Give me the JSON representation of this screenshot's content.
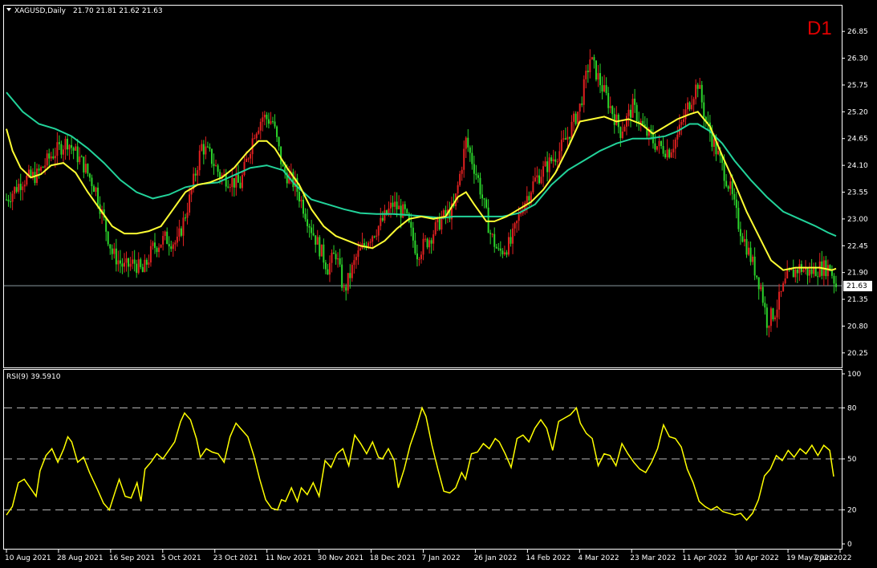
{
  "header": {
    "symbol": "XAGUSD,Daily",
    "ohlc": "21.70 21.81 21.62 21.63",
    "timeframe_badge": "D1"
  },
  "rsi_header": {
    "label": "RSI(9) 39.5910"
  },
  "last_price_label": "21.63",
  "colors": {
    "background": "#000000",
    "bull": "#e02020",
    "bear": "#2bd42b",
    "fast_ma": "#ffff33",
    "slow_ma": "#22d39a",
    "rsi": "#ffff00",
    "grid": "#ffffff",
    "last_price_line": "#8a9aa0"
  },
  "chart_data": [
    {
      "type": "candlestick",
      "title": "XAGUSD,Daily",
      "ylim": [
        20.05,
        27.1
      ],
      "y_ticks": [
        "26.85",
        "26.30",
        "25.75",
        "25.20",
        "24.65",
        "24.10",
        "23.55",
        "23.00",
        "22.45",
        "21.90",
        "21.35",
        "20.80",
        "20.25"
      ],
      "x_ticks": [
        "10 Aug 2021",
        "28 Aug 2021",
        "16 Sep 2021",
        "5 Oct 2021",
        "23 Oct 2021",
        "11 Nov 2021",
        "30 Nov 2021",
        "18 Dec 2021",
        "7 Jan 2022",
        "26 Jan 2022",
        "14 Feb 2022",
        "4 Mar 2022",
        "23 Mar 2022",
        "11 Apr 2022",
        "30 Apr 2022",
        "19 May 2022",
        "7 Jun 2022"
      ],
      "last_price": 21.63,
      "close_path": [
        [
          0,
          23.4
        ],
        [
          8,
          23.8
        ],
        [
          15,
          23.9
        ],
        [
          22,
          24.3
        ],
        [
          30,
          24.6
        ],
        [
          38,
          24.1
        ],
        [
          44,
          23.6
        ],
        [
          52,
          22.3
        ],
        [
          58,
          22.0
        ],
        [
          63,
          22.1
        ],
        [
          67,
          21.9
        ],
        [
          72,
          22.4
        ],
        [
          78,
          22.6
        ],
        [
          84,
          22.5
        ],
        [
          90,
          23.4
        ],
        [
          96,
          24.5
        ],
        [
          100,
          24.3
        ],
        [
          105,
          23.9
        ],
        [
          110,
          23.8
        ],
        [
          115,
          23.7
        ],
        [
          122,
          24.8
        ],
        [
          126,
          25.1
        ],
        [
          131,
          25.0
        ],
        [
          136,
          24.0
        ],
        [
          142,
          23.7
        ],
        [
          150,
          22.8
        ],
        [
          158,
          22.0
        ],
        [
          162,
          22.3
        ],
        [
          166,
          21.5
        ],
        [
          172,
          22.2
        ],
        [
          178,
          22.6
        ],
        [
          184,
          22.9
        ],
        [
          190,
          23.3
        ],
        [
          196,
          23.1
        ],
        [
          202,
          22.3
        ],
        [
          208,
          22.6
        ],
        [
          214,
          23.0
        ],
        [
          220,
          23.2
        ],
        [
          226,
          24.6
        ],
        [
          232,
          23.8
        ],
        [
          238,
          22.7
        ],
        [
          242,
          22.3
        ],
        [
          248,
          22.5
        ],
        [
          254,
          23.3
        ],
        [
          260,
          23.8
        ],
        [
          266,
          24.1
        ],
        [
          272,
          24.4
        ],
        [
          276,
          24.7
        ],
        [
          282,
          25.3
        ],
        [
          287,
          26.3
        ],
        [
          292,
          25.8
        ],
        [
          296,
          25.4
        ],
        [
          302,
          24.8
        ],
        [
          308,
          25.3
        ],
        [
          314,
          24.8
        ],
        [
          320,
          24.5
        ],
        [
          326,
          24.4
        ],
        [
          330,
          24.7
        ],
        [
          335,
          25.3
        ],
        [
          340,
          25.8
        ],
        [
          344,
          25.0
        ],
        [
          350,
          24.3
        ],
        [
          356,
          23.6
        ],
        [
          360,
          22.9
        ],
        [
          366,
          22.2
        ],
        [
          371,
          21.6
        ],
        [
          374,
          20.9
        ],
        [
          378,
          21.1
        ],
        [
          384,
          21.8
        ],
        [
          390,
          22.0
        ],
        [
          395,
          21.9
        ],
        [
          400,
          22.0
        ],
        [
          405,
          22.0
        ],
        [
          408,
          21.63
        ]
      ],
      "fast_ma": [
        [
          0,
          24.85
        ],
        [
          3,
          24.4
        ],
        [
          7,
          24.05
        ],
        [
          12,
          23.85
        ],
        [
          17,
          23.92
        ],
        [
          22,
          24.1
        ],
        [
          28,
          24.15
        ],
        [
          34,
          23.95
        ],
        [
          40,
          23.55
        ],
        [
          46,
          23.2
        ],
        [
          52,
          22.85
        ],
        [
          58,
          22.7
        ],
        [
          64,
          22.7
        ],
        [
          70,
          22.75
        ],
        [
          76,
          22.85
        ],
        [
          82,
          23.2
        ],
        [
          88,
          23.55
        ],
        [
          94,
          23.7
        ],
        [
          100,
          23.75
        ],
        [
          106,
          23.85
        ],
        [
          112,
          24.05
        ],
        [
          118,
          24.35
        ],
        [
          124,
          24.6
        ],
        [
          128,
          24.6
        ],
        [
          132,
          24.45
        ],
        [
          138,
          24.05
        ],
        [
          144,
          23.7
        ],
        [
          150,
          23.2
        ],
        [
          156,
          22.85
        ],
        [
          162,
          22.65
        ],
        [
          168,
          22.55
        ],
        [
          174,
          22.45
        ],
        [
          180,
          22.4
        ],
        [
          186,
          22.55
        ],
        [
          192,
          22.8
        ],
        [
          198,
          23.0
        ],
        [
          204,
          23.05
        ],
        [
          210,
          23.0
        ],
        [
          216,
          23.05
        ],
        [
          222,
          23.45
        ],
        [
          226,
          23.55
        ],
        [
          230,
          23.3
        ],
        [
          236,
          22.95
        ],
        [
          240,
          22.95
        ],
        [
          246,
          23.05
        ],
        [
          252,
          23.2
        ],
        [
          258,
          23.35
        ],
        [
          264,
          23.6
        ],
        [
          270,
          23.95
        ],
        [
          276,
          24.45
        ],
        [
          282,
          25.0
        ],
        [
          288,
          25.05
        ],
        [
          294,
          25.1
        ],
        [
          300,
          25.0
        ],
        [
          306,
          25.05
        ],
        [
          312,
          24.95
        ],
        [
          318,
          24.75
        ],
        [
          324,
          24.9
        ],
        [
          330,
          25.05
        ],
        [
          336,
          25.15
        ],
        [
          340,
          25.2
        ],
        [
          346,
          24.9
        ],
        [
          352,
          24.3
        ],
        [
          358,
          23.75
        ],
        [
          364,
          23.15
        ],
        [
          370,
          22.65
        ],
        [
          376,
          22.15
        ],
        [
          382,
          21.95
        ],
        [
          388,
          22.0
        ],
        [
          394,
          22.0
        ],
        [
          400,
          22.0
        ],
        [
          406,
          21.95
        ],
        [
          408,
          21.98
        ]
      ],
      "slow_ma": [
        [
          0,
          25.6
        ],
        [
          8,
          25.2
        ],
        [
          16,
          24.95
        ],
        [
          24,
          24.85
        ],
        [
          32,
          24.7
        ],
        [
          40,
          24.45
        ],
        [
          48,
          24.15
        ],
        [
          56,
          23.8
        ],
        [
          64,
          23.55
        ],
        [
          72,
          23.42
        ],
        [
          80,
          23.5
        ],
        [
          88,
          23.65
        ],
        [
          96,
          23.72
        ],
        [
          104,
          23.75
        ],
        [
          112,
          23.9
        ],
        [
          120,
          24.05
        ],
        [
          128,
          24.1
        ],
        [
          136,
          24.0
        ],
        [
          142,
          23.7
        ],
        [
          150,
          23.4
        ],
        [
          158,
          23.3
        ],
        [
          166,
          23.2
        ],
        [
          174,
          23.12
        ],
        [
          182,
          23.1
        ],
        [
          190,
          23.1
        ],
        [
          198,
          23.08
        ],
        [
          206,
          23.05
        ],
        [
          214,
          23.02
        ],
        [
          220,
          23.05
        ],
        [
          228,
          23.05
        ],
        [
          236,
          23.05
        ],
        [
          244,
          23.05
        ],
        [
          252,
          23.12
        ],
        [
          260,
          23.3
        ],
        [
          268,
          23.7
        ],
        [
          276,
          24.0
        ],
        [
          284,
          24.2
        ],
        [
          292,
          24.4
        ],
        [
          300,
          24.55
        ],
        [
          308,
          24.65
        ],
        [
          316,
          24.65
        ],
        [
          324,
          24.7
        ],
        [
          330,
          24.8
        ],
        [
          336,
          24.95
        ],
        [
          340,
          24.95
        ],
        [
          346,
          24.8
        ],
        [
          352,
          24.55
        ],
        [
          358,
          24.2
        ],
        [
          366,
          23.8
        ],
        [
          374,
          23.45
        ],
        [
          382,
          23.15
        ],
        [
          390,
          23.0
        ],
        [
          398,
          22.85
        ],
        [
          404,
          22.72
        ],
        [
          408,
          22.65
        ]
      ]
    },
    {
      "type": "line",
      "title": "RSI(9) 39.5910",
      "ylim": [
        0,
        100
      ],
      "y_ticks": [
        "100",
        "80",
        "50",
        "20",
        "0"
      ],
      "levels": [
        80,
        50,
        20
      ],
      "rsi_path": [
        [
          0,
          17
        ],
        [
          3,
          22
        ],
        [
          6,
          36
        ],
        [
          9,
          38
        ],
        [
          12,
          33
        ],
        [
          15,
          28
        ],
        [
          17,
          43
        ],
        [
          20,
          52
        ],
        [
          23,
          56
        ],
        [
          26,
          48
        ],
        [
          29,
          56
        ],
        [
          31,
          63
        ],
        [
          33,
          60
        ],
        [
          36,
          48
        ],
        [
          39,
          51
        ],
        [
          42,
          42
        ],
        [
          46,
          32
        ],
        [
          49,
          24
        ],
        [
          52,
          20
        ],
        [
          55,
          31
        ],
        [
          57,
          38
        ],
        [
          60,
          28
        ],
        [
          63,
          27
        ],
        [
          66,
          36
        ],
        [
          68,
          25
        ],
        [
          70,
          44
        ],
        [
          73,
          48
        ],
        [
          76,
          53
        ],
        [
          79,
          50
        ],
        [
          82,
          55
        ],
        [
          85,
          60
        ],
        [
          88,
          72
        ],
        [
          90,
          77
        ],
        [
          93,
          73
        ],
        [
          96,
          62
        ],
        [
          98,
          51
        ],
        [
          101,
          56
        ],
        [
          104,
          54
        ],
        [
          107,
          53
        ],
        [
          110,
          48
        ],
        [
          113,
          63
        ],
        [
          116,
          71
        ],
        [
          119,
          67
        ],
        [
          122,
          63
        ],
        [
          125,
          52
        ],
        [
          128,
          38
        ],
        [
          131,
          26
        ],
        [
          134,
          21
        ],
        [
          137,
          20
        ],
        [
          139,
          26
        ],
        [
          141,
          25
        ],
        [
          144,
          33
        ],
        [
          147,
          25
        ],
        [
          149,
          33
        ],
        [
          152,
          29
        ],
        [
          155,
          36
        ],
        [
          158,
          28
        ],
        [
          161,
          49
        ],
        [
          164,
          45
        ],
        [
          167,
          53
        ],
        [
          170,
          56
        ],
        [
          173,
          46
        ],
        [
          176,
          64
        ],
        [
          179,
          59
        ],
        [
          182,
          53
        ],
        [
          185,
          60
        ],
        [
          188,
          51
        ],
        [
          190,
          50
        ],
        [
          193,
          56
        ],
        [
          196,
          49
        ],
        [
          198,
          33
        ],
        [
          201,
          44
        ],
        [
          204,
          58
        ],
        [
          207,
          68
        ],
        [
          210,
          80
        ],
        [
          212,
          75
        ],
        [
          215,
          58
        ],
        [
          218,
          44
        ],
        [
          221,
          31
        ],
        [
          224,
          30
        ],
        [
          227,
          33
        ],
        [
          230,
          42
        ],
        [
          232,
          38
        ],
        [
          235,
          53
        ],
        [
          238,
          54
        ],
        [
          241,
          59
        ],
        [
          244,
          56
        ],
        [
          247,
          62
        ],
        [
          249,
          60
        ],
        [
          252,
          53
        ],
        [
          255,
          45
        ],
        [
          258,
          62
        ],
        [
          261,
          64
        ],
        [
          264,
          60
        ],
        [
          267,
          68
        ],
        [
          270,
          73
        ],
        [
          273,
          68
        ],
        [
          276,
          55
        ],
        [
          279,
          72
        ],
        [
          282,
          74
        ],
        [
          285,
          76
        ],
        [
          288,
          80
        ],
        [
          290,
          71
        ],
        [
          293,
          65
        ],
        [
          296,
          62
        ],
        [
          299,
          46
        ],
        [
          302,
          53
        ],
        [
          305,
          52
        ],
        [
          308,
          46
        ],
        [
          311,
          59
        ],
        [
          314,
          53
        ],
        [
          317,
          48
        ],
        [
          320,
          44
        ],
        [
          323,
          42
        ],
        [
          326,
          48
        ],
        [
          329,
          56
        ],
        [
          332,
          70
        ],
        [
          335,
          63
        ],
        [
          338,
          62
        ],
        [
          341,
          57
        ],
        [
          344,
          44
        ],
        [
          347,
          36
        ],
        [
          350,
          25
        ],
        [
          353,
          22
        ],
        [
          356,
          20
        ],
        [
          359,
          22
        ],
        [
          362,
          19
        ],
        [
          365,
          18
        ],
        [
          368,
          17
        ],
        [
          371,
          18
        ],
        [
          374,
          14
        ],
        [
          377,
          18
        ],
        [
          380,
          26
        ],
        [
          383,
          40
        ],
        [
          386,
          44
        ],
        [
          389,
          52
        ],
        [
          392,
          49
        ],
        [
          395,
          55
        ],
        [
          398,
          51
        ],
        [
          401,
          56
        ],
        [
          404,
          53
        ],
        [
          407,
          58
        ],
        [
          410,
          52
        ],
        [
          413,
          58
        ],
        [
          416,
          55
        ],
        [
          418,
          39.6
        ]
      ]
    }
  ]
}
